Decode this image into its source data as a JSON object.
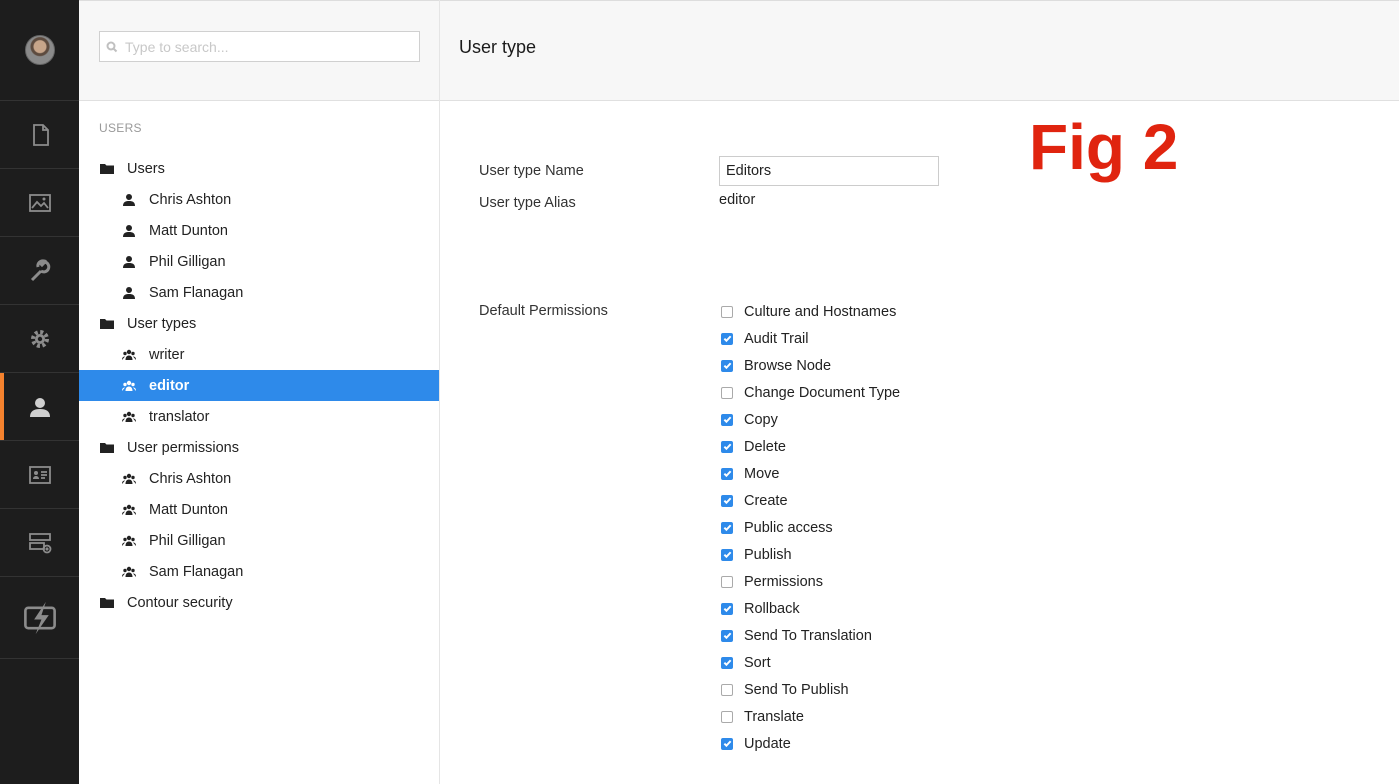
{
  "appbar": {
    "sections": [
      {
        "icon": "document-icon"
      },
      {
        "icon": "media-icon"
      },
      {
        "icon": "wrench-icon"
      },
      {
        "icon": "gear-icon"
      },
      {
        "icon": "user-icon",
        "active": true
      },
      {
        "icon": "member-card-icon"
      },
      {
        "icon": "forms-icon"
      },
      {
        "icon": "contour-plugin-icon"
      }
    ],
    "accent_color": "#f5822e"
  },
  "search": {
    "placeholder": "Type to search..."
  },
  "tree": {
    "root_label": "USERS",
    "users_folder": "Users",
    "users": [
      "Chris Ashton",
      "Matt Dunton",
      "Phil Gilligan",
      "Sam Flanagan"
    ],
    "user_types_folder": "User types",
    "user_types": [
      "writer",
      "editor",
      "translator"
    ],
    "selected": "editor",
    "user_permissions_folder": "User permissions",
    "user_permissions": [
      "Chris Ashton",
      "Matt Dunton",
      "Phil Gilligan",
      "Sam Flanagan"
    ],
    "contour_folder": "Contour security",
    "selected_color": "#2e8aea"
  },
  "header": {
    "title": "User type"
  },
  "annotation": "Fig 2",
  "form": {
    "name_label": "User type Name",
    "name_value": "Editors",
    "alias_label": "User type Alias",
    "alias_value": "editor",
    "permissions_label": "Default Permissions",
    "permissions": [
      {
        "label": "Culture and Hostnames",
        "checked": false
      },
      {
        "label": "Audit Trail",
        "checked": true
      },
      {
        "label": "Browse Node",
        "checked": true
      },
      {
        "label": "Change Document Type",
        "checked": false
      },
      {
        "label": "Copy",
        "checked": true
      },
      {
        "label": "Delete",
        "checked": true
      },
      {
        "label": "Move",
        "checked": true
      },
      {
        "label": "Create",
        "checked": true
      },
      {
        "label": "Public access",
        "checked": true
      },
      {
        "label": "Publish",
        "checked": true
      },
      {
        "label": "Permissions",
        "checked": false
      },
      {
        "label": "Rollback",
        "checked": true
      },
      {
        "label": "Send To Translation",
        "checked": true
      },
      {
        "label": "Sort",
        "checked": true
      },
      {
        "label": "Send To Publish",
        "checked": false
      },
      {
        "label": "Translate",
        "checked": false
      },
      {
        "label": "Update",
        "checked": true
      }
    ]
  }
}
